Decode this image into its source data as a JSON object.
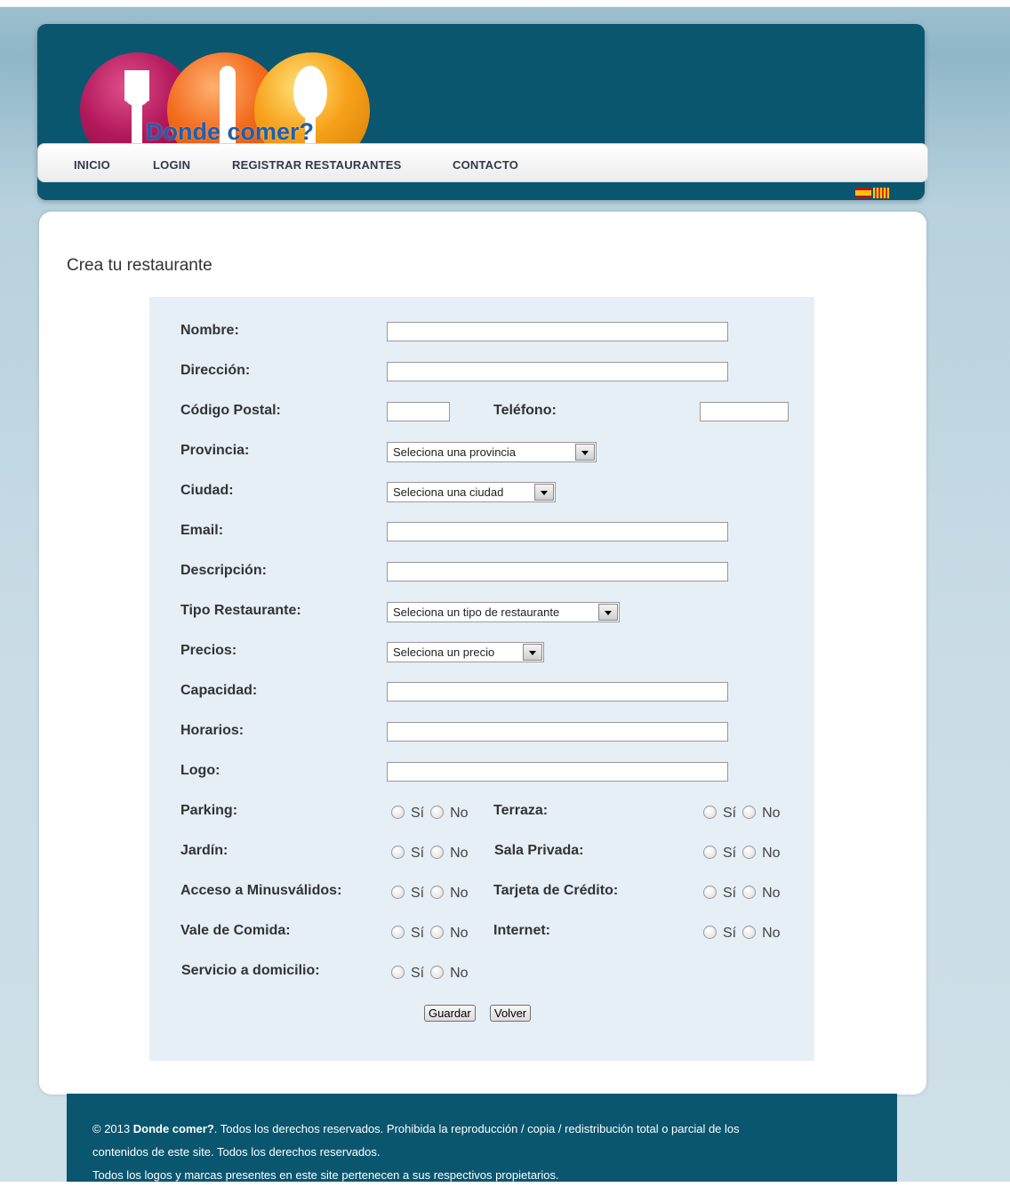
{
  "brand": {
    "name": "Donde comer?"
  },
  "nav": {
    "items": [
      {
        "label": "INICIO"
      },
      {
        "label": "LOGIN"
      },
      {
        "label": "REGISTRAR RESTAURANTES"
      },
      {
        "label": "CONTACTO"
      }
    ]
  },
  "languages": [
    "es-flag-icon",
    "cat-flag-icon"
  ],
  "page": {
    "title": "Crea tu restaurante"
  },
  "form": {
    "nombre_label": "Nombre:",
    "direccion_label": "Dirección:",
    "codigo_postal_label": "Código Postal:",
    "telefono_label": "Teléfono:",
    "provincia_label": "Provincia:",
    "provincia_value": "Seleciona una provincia",
    "ciudad_label": "Ciudad:",
    "ciudad_value": "Seleciona una ciudad",
    "email_label": "Email:",
    "descripcion_label": "Descripción:",
    "tipo_label": "Tipo Restaurante:",
    "tipo_value": "Seleciona un tipo de restaurante",
    "precios_label": "Precios:",
    "precios_value": "Seleciona un precio",
    "capacidad_label": "Capacidad:",
    "horarios_label": "Horarios:",
    "logo_label": "Logo:",
    "yes": "Sí",
    "no": "No",
    "parking_label": "Parking:",
    "terraza_label": "Terraza:",
    "jardin_label": "Jardín:",
    "sala_privada_label": "Sala Privada:",
    "minusvalidos_label": "Acceso a Minusválidos:",
    "tarjeta_label": "Tarjeta de Crédito:",
    "vale_label": "Vale de Comida:",
    "internet_label": "Internet:",
    "domicilio_label": "Servicio a domicilio:",
    "guardar": "Guardar",
    "volver": "Volver"
  },
  "footer": {
    "year": "© 2013",
    "brand": "Donde comer?",
    "line1_rest": ". Todos los derechos reservados. Prohibida la reproducción / copia / redistribución total o parcial de los",
    "line2": "contenidos de este site. Todos los derechos reservados.",
    "line3": "Todos los logos y marcas presentes en este site pertenecen a sus respectivos propietarios."
  },
  "colors": {
    "header_bg": "#0a566f",
    "form_bg": "#e6eff6",
    "logo_text": "#1f5fae"
  }
}
